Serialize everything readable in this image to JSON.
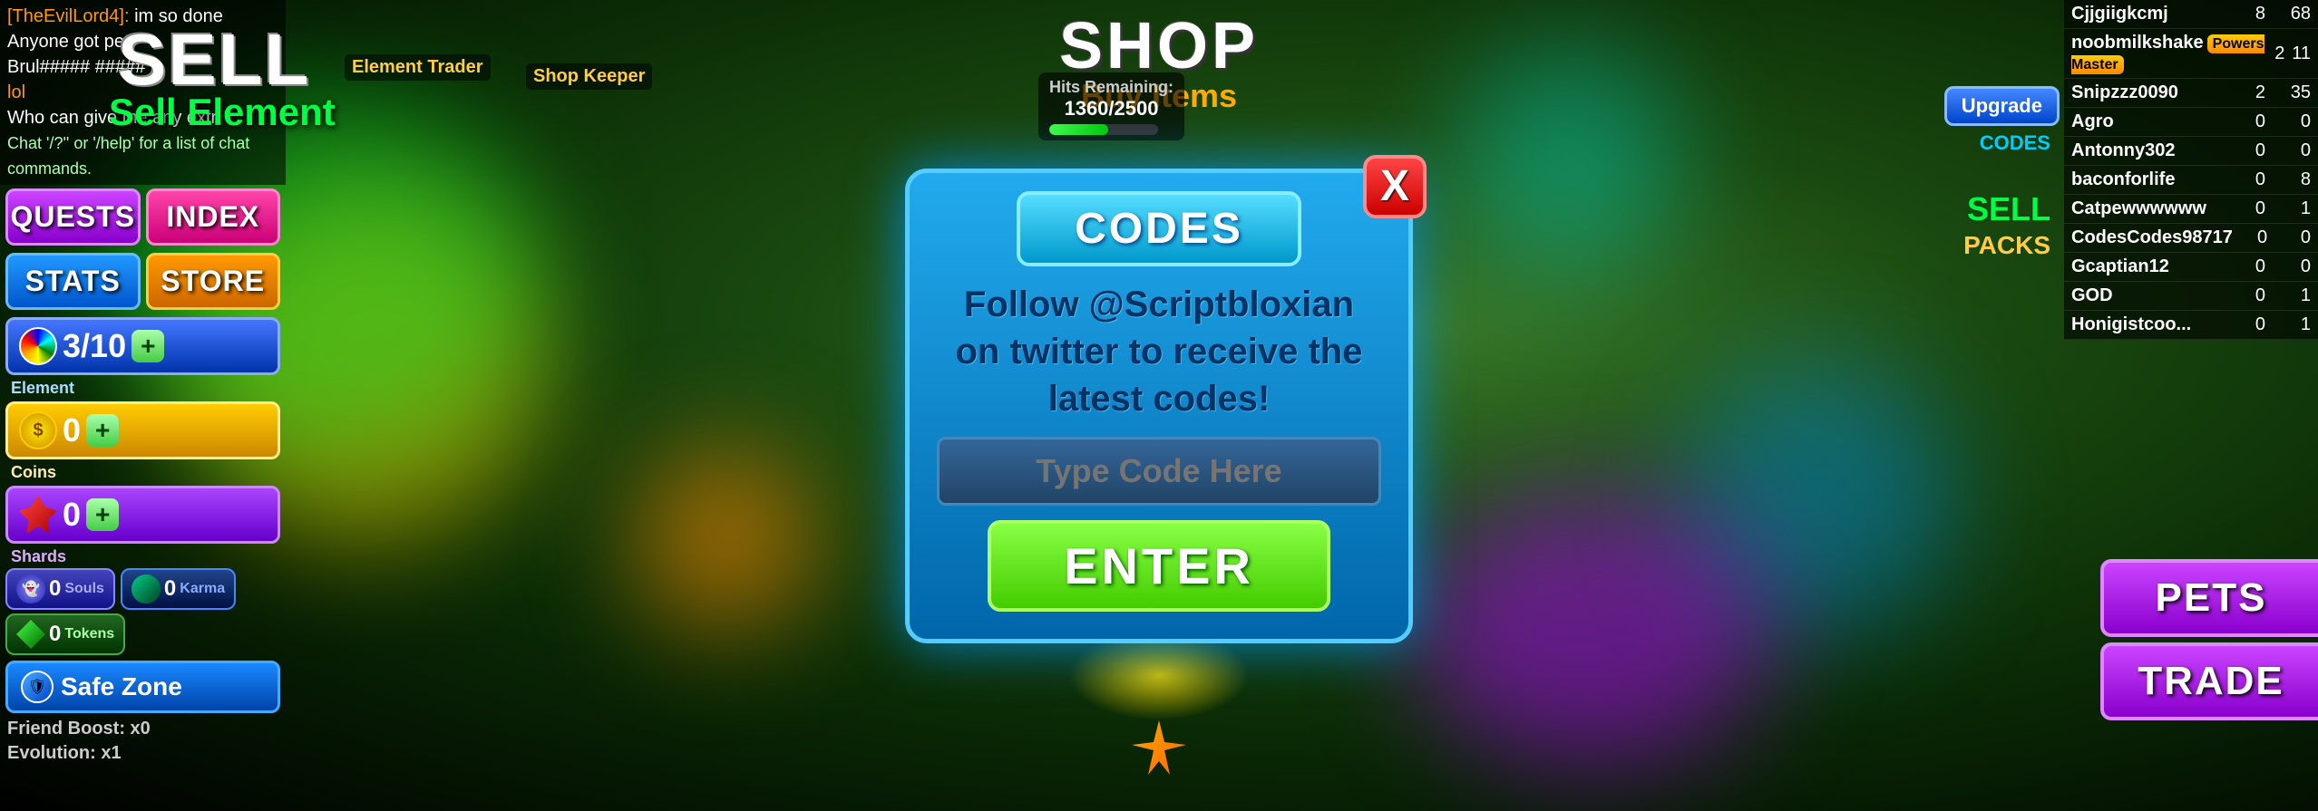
{
  "game": {
    "title": "SHOP",
    "subtitle": "Buy Items"
  },
  "chat": {
    "lines": [
      {
        "name": "[TheEvilLord4]:",
        "text": " im so done"
      },
      {
        "name": "Anyone got pet",
        "text": ""
      },
      {
        "name": "Brul##### #####",
        "text": ""
      },
      {
        "name": "lol",
        "text": ""
      },
      {
        "name": "Who can give me any extr",
        "text": ""
      }
    ],
    "hint": "Chat '/?'' or '/help' for a list of chat commands."
  },
  "leftHud": {
    "sellText": "SELL",
    "sellElementText": "Sell Element",
    "buttons": {
      "quests": "QUESTS",
      "index": "INDEX",
      "stats": "STATS",
      "store": "STORE"
    },
    "element": {
      "current": "3",
      "max": "10",
      "label": "Element"
    },
    "coins": {
      "value": "0",
      "label": "Coins"
    },
    "shards": {
      "value": "0",
      "label": "Shards"
    },
    "souls": {
      "value": "0",
      "label": "Souls"
    },
    "karma": {
      "value": "0",
      "label": "Karma"
    },
    "tokens": {
      "value": "0",
      "label": "Tokens"
    },
    "safeZone": "Safe Zone",
    "friendBoost": "Friend Boost: x0",
    "evolution": "Evolution: x1"
  },
  "codesModal": {
    "codesButtonLabel": "CODES",
    "description": "Follow @Scriptbloxian on twitter to receive the latest codes!",
    "inputPlaceholder": "Type Code Here",
    "enterButton": "ENTER",
    "closeButton": "X"
  },
  "hitsRemaining": {
    "label": "Hits Remaining:",
    "current": "1360",
    "max": "2500"
  },
  "labels": {
    "elementTrader": "Element Trader",
    "shopKeeper": "Shop Keeper",
    "upgrade": "Upgrade",
    "codesSide": "CODES",
    "sell": "SELL",
    "packs": "PACKS",
    "pets": "PETS",
    "trade": "TRADE"
  },
  "leaderboard": {
    "rows": [
      {
        "name": "Cjjgiigkcmj",
        "val1": "8",
        "val2": "68"
      },
      {
        "name": "noobmilkshake",
        "val1": "2",
        "val2": "11",
        "badge": "Powers Master"
      },
      {
        "name": "Snipzzz0090",
        "val1": "2",
        "val2": "35"
      },
      {
        "name": "Agro",
        "val1": "0",
        "val2": "0"
      },
      {
        "name": "Antonny302",
        "val1": "0",
        "val2": "0"
      },
      {
        "name": "baconforlife",
        "val1": "0",
        "val2": "8"
      },
      {
        "name": "Catpewwwwww",
        "val1": "0",
        "val2": "1"
      },
      {
        "name": "CodesCodes98717",
        "val1": "0",
        "val2": "0"
      },
      {
        "name": "Gcaptian12",
        "val1": "0",
        "val2": "0"
      },
      {
        "name": "GOD",
        "val1": "0",
        "val2": "1"
      },
      {
        "name": "Honigistcoo...",
        "val1": "0",
        "val2": "1"
      }
    ]
  }
}
